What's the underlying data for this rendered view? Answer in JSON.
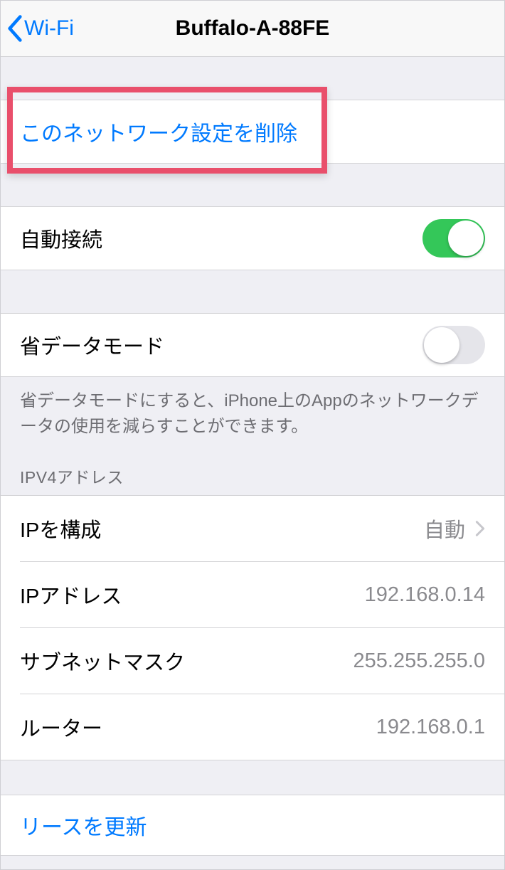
{
  "header": {
    "back_label": "Wi-Fi",
    "title": "Buffalo-A-88FE"
  },
  "forget": {
    "label": "このネットワーク設定を削除"
  },
  "auto_join": {
    "label": "自動接続",
    "on": true
  },
  "low_data": {
    "label": "省データモード",
    "on": false,
    "footer": "省データモードにすると、iPhone上のAppのネットワークデータの使用を減らすことができます。"
  },
  "ipv4": {
    "section_title": "IPV4アドレス",
    "configure_label": "IPを構成",
    "configure_value": "自動",
    "ip_label": "IPアドレス",
    "ip_value": "192.168.0.14",
    "subnet_label": "サブネットマスク",
    "subnet_value": "255.255.255.0",
    "router_label": "ルーター",
    "router_value": "192.168.0.1"
  },
  "renew": {
    "label": "リースを更新"
  }
}
